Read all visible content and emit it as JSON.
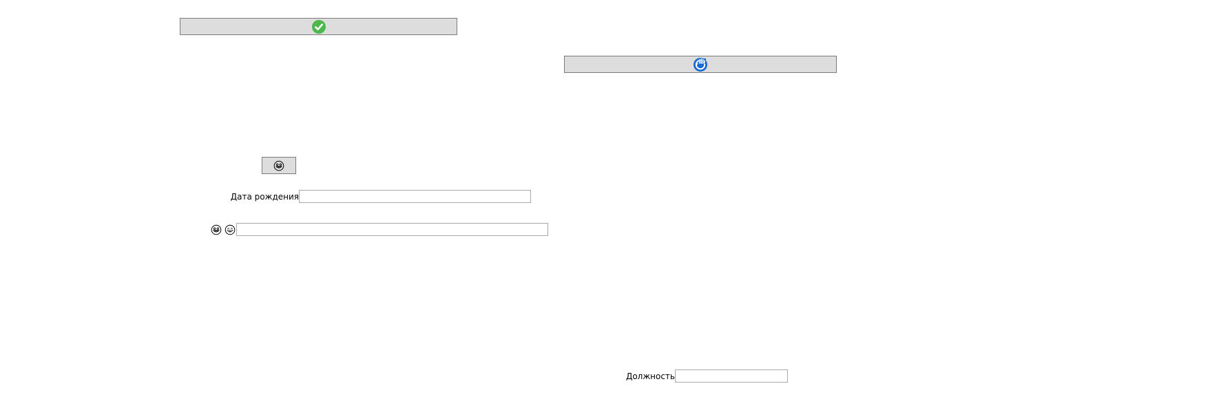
{
  "buttons": {
    "confirm_icon": "check-circle-icon",
    "refresh_icon": "refresh-hand-icon",
    "emoji_icon": "grinning-face-icon"
  },
  "fields": {
    "birth_date": {
      "label": "Дата рождения",
      "value": "",
      "placeholder": ""
    },
    "emoji_row": {
      "icons": [
        "grinning-face-icon",
        "smiling-face-icon"
      ],
      "value": "",
      "placeholder": ""
    },
    "position": {
      "label": "Должность",
      "value": "",
      "placeholder": ""
    }
  },
  "colors": {
    "button_bg": "#dddddd",
    "button_border": "#7a7a7a",
    "check_green": "#4cb84c",
    "refresh_blue": "#1769d0",
    "field_border": "#a9a9a9"
  }
}
